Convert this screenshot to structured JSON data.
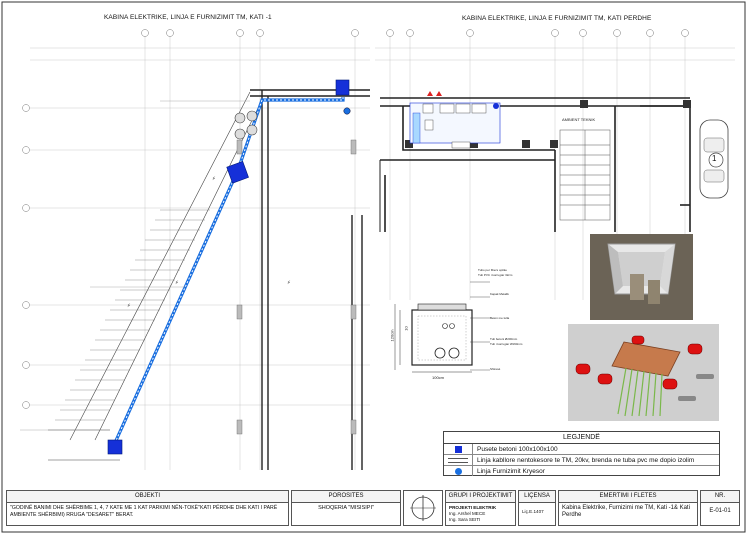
{
  "plans": {
    "left_title": "KABINA ELEKTRIKE, LINJA E FURNIZIMIT TM, KATI -1",
    "right_title": "KABINA ELEKTRIKE, LINJA E FURNIZIMIT TM, KATI PERDHE",
    "room_label": "AMBIENT TEKNIK",
    "parking_number": "1"
  },
  "section": {
    "labels": [
      "Tubo per fibers optike",
      "Tub PVC i korrugiar 32cm",
      "Kapak Metalik",
      "Beton me tulla",
      "Tub betoni Ø200mm",
      "Tub i korrugiar Ø160mm",
      "Shtresë"
    ],
    "dim_width": "100cm",
    "dim_height": "120cm",
    "dim_inner": "10"
  },
  "legend": {
    "title": "LEGJENDË",
    "items": [
      {
        "label": "Pusete betoni 100x100x100",
        "color": "#1530d8"
      },
      {
        "label": "Linja kabllore nentokesore te TM, 20kv, brenda ne tuba pvc me dopio izolim",
        "color": "#555555"
      },
      {
        "label": "Linja Furnizimit Kryesor",
        "color": "#1a6fe0"
      }
    ]
  },
  "title_block": {
    "objekti_header": "OBJEKTI",
    "objekti_text": "\"GODINË BANIMI DHE SHËRBIME 1, 4, 7 KATE ME 1 KAT PARKIMI NËN-TOKË\"KATI PËRDHE DHE KATI I PARË AMBIENTE SHËRBIMI) RRUGA \"DESARET\" BERAT.",
    "porosites_header": "POROSITES",
    "porosites_text": "SHOQERIA \"MISISIPI\"",
    "grupi_header": "GRUPI I PROJEKTIMIT",
    "grupi_lines": [
      "PROJEKTI ELEKTRIK",
      "Ing. Arshel MECE",
      "Ing. Sara SEITI"
    ],
    "licensa_header": "LIÇENSA",
    "licensa_text": "Liç.E.1407",
    "emertimi_header": "EMERTIMI I FLETES",
    "emertimi_text": "Kabina Elektrike, Furnizimi me TM, Kati -1& Kati Perdhe",
    "nr_header": "NR.",
    "nr_text": "E-01-01"
  },
  "colors": {
    "accent": "#1530d8",
    "line": "#1a6fe0"
  }
}
